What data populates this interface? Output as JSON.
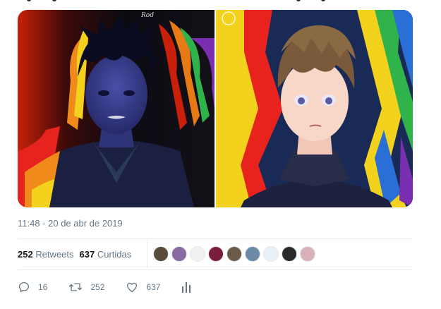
{
  "tweet": {
    "timestamp": "11:48 - 20 de abr de 2019",
    "stats": {
      "retweets_count": "252",
      "retweets_label": "Retweets",
      "likes_count": "637",
      "likes_label": "Curtidas"
    },
    "liked_by_avatars": [
      {
        "name": "avatar-1",
        "color": "#5a4a3a"
      },
      {
        "name": "avatar-2",
        "color": "#8a6aa0"
      },
      {
        "name": "avatar-3",
        "color": "#f0f0f0"
      },
      {
        "name": "avatar-4",
        "color": "#7a1e3a"
      },
      {
        "name": "avatar-5",
        "color": "#6b5a4a"
      },
      {
        "name": "avatar-6",
        "color": "#6a8aa8"
      },
      {
        "name": "avatar-7",
        "color": "#e8f0f8"
      },
      {
        "name": "avatar-8",
        "color": "#2a2a2a"
      },
      {
        "name": "avatar-9",
        "color": "#d8b0b8"
      }
    ],
    "actions": {
      "reply_count": "16",
      "retweet_count": "252",
      "like_count": "637"
    }
  },
  "media": {
    "left_image": {
      "watermark": "Rod"
    },
    "icons": [
      "reply-icon",
      "retweet-icon",
      "like-icon",
      "analytics-icon"
    ]
  },
  "colors": {
    "secondary_text": "#657786",
    "primary_text": "#14171a",
    "divider": "#e6ecf0"
  }
}
